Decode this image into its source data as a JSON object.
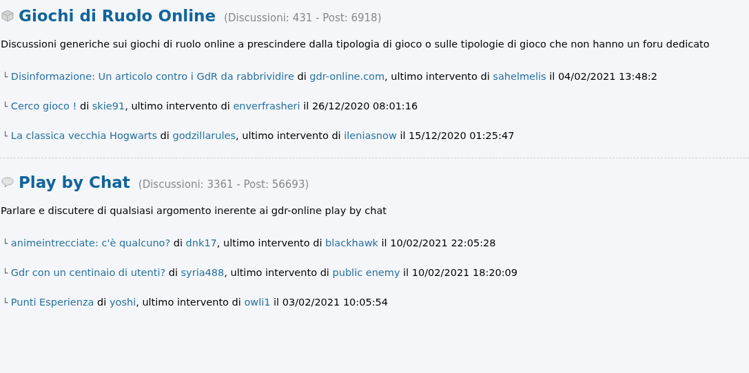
{
  "forums": [
    {
      "kind": "cube",
      "title": "Giochi di Ruolo Online",
      "stats": "(Discussioni: 431 - Post: 6918)",
      "description": "Discussioni generiche sui giochi di ruolo online a prescindere dalla tipologia di gioco o sulle tipologie di gioco che non hanno un foru dedicato",
      "topics": [
        {
          "branch": "└",
          "parts": [
            {
              "kind": "link",
              "text": "Disinformazione: Un articolo contro i GdR da rabbrividire"
            },
            {
              "kind": "text",
              "text": " di "
            },
            {
              "kind": "link",
              "text": "gdr-online.com"
            },
            {
              "kind": "text",
              "text": ", ultimo intervento di "
            },
            {
              "kind": "link",
              "text": "sahelmelis"
            },
            {
              "kind": "text",
              "text": " il 04/02/2021 13:48:2"
            }
          ]
        },
        {
          "branch": "└",
          "parts": [
            {
              "kind": "link",
              "text": "Cerco gioco !"
            },
            {
              "kind": "text",
              "text": " di "
            },
            {
              "kind": "link",
              "text": "skie91"
            },
            {
              "kind": "text",
              "text": ", ultimo intervento di "
            },
            {
              "kind": "link",
              "text": "enverfrasheri"
            },
            {
              "kind": "text",
              "text": " il 26/12/2020 08:01:16"
            }
          ]
        },
        {
          "branch": "└",
          "parts": [
            {
              "kind": "link",
              "text": "La classica vecchia Hogwarts"
            },
            {
              "kind": "text",
              "text": " di "
            },
            {
              "kind": "link",
              "text": "godzillarules"
            },
            {
              "kind": "text",
              "text": ", ultimo intervento di "
            },
            {
              "kind": "link",
              "text": "ileniasnow"
            },
            {
              "kind": "text",
              "text": " il 15/12/2020 01:25:47"
            }
          ]
        }
      ]
    },
    {
      "kind": "chat",
      "title": "Play by Chat",
      "stats": "(Discussioni: 3361 - Post: 56693)",
      "description": "Parlare e discutere di qualsiasi argomento inerente ai gdr-online play by chat",
      "topics": [
        {
          "branch": "└",
          "parts": [
            {
              "kind": "link",
              "text": "animeintrecciate: c'è qualcuno?"
            },
            {
              "kind": "text",
              "text": " di "
            },
            {
              "kind": "link",
              "text": "dnk17"
            },
            {
              "kind": "text",
              "text": ", ultimo intervento di "
            },
            {
              "kind": "link",
              "text": "blackhawk"
            },
            {
              "kind": "text",
              "text": " il 10/02/2021 22:05:28"
            }
          ]
        },
        {
          "branch": "└",
          "parts": [
            {
              "kind": "link",
              "text": "Gdr con un centinaio di utenti?"
            },
            {
              "kind": "text",
              "text": " di "
            },
            {
              "kind": "link",
              "text": "syria488"
            },
            {
              "kind": "text",
              "text": ", ultimo intervento di "
            },
            {
              "kind": "link",
              "text": "public enemy"
            },
            {
              "kind": "text",
              "text": " il 10/02/2021 18:20:09"
            }
          ]
        },
        {
          "branch": "└",
          "parts": [
            {
              "kind": "link",
              "text": "Punti Esperienza"
            },
            {
              "kind": "text",
              "text": " di "
            },
            {
              "kind": "link",
              "text": "yoshi"
            },
            {
              "kind": "text",
              "text": ", ultimo intervento di "
            },
            {
              "kind": "link",
              "text": "owli1"
            },
            {
              "kind": "text",
              "text": " il 03/02/2021 10:05:54"
            }
          ]
        }
      ]
    }
  ]
}
